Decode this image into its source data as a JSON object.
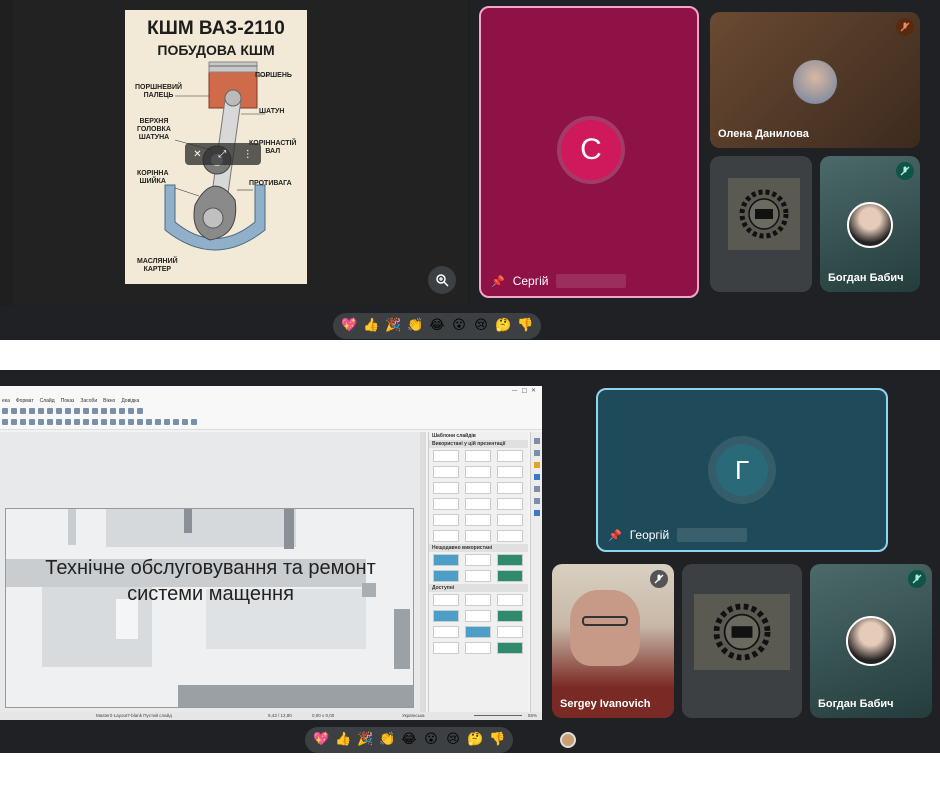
{
  "screenshot1": {
    "poster": {
      "title": "КШМ ВАЗ-2110",
      "subtitle": "ПОБУДОВА КШМ",
      "labels": {
        "piston": "ПОРШЕНЬ",
        "pin": "ПОРШНЕВИЙ\nПАЛЕЦЬ",
        "rod": "ШАТУН",
        "upper_head": "ВЕРХНЯ\nГОЛОВКА\nШАТУНА",
        "crankshaft": "КОРІННАСТІЙ\nВАЛ",
        "journal": "КОРІННА\nШИЙКА",
        "counterweight": "ПРОТИВАГА",
        "oil_pan": "МАСЛЯНИЙ\nКАРТЕР"
      }
    },
    "pinned_participant": {
      "initial": "С",
      "name": "Сергій"
    },
    "participants": [
      {
        "name": "Олена Данилова"
      },
      {
        "name": ""
      },
      {
        "name": "Богдан Бабич"
      }
    ],
    "colors": {
      "pinned_bg": "#8e1246",
      "avatar_bg": "#d0185c",
      "highlight_border": "#f3a6c8"
    }
  },
  "screenshot2": {
    "app_menu": [
      "ека",
      "Формат",
      "Слайд",
      "Показ",
      "Засоби",
      "Вікно",
      "Довідка"
    ],
    "slide_title": "Технічне обслуговування та ремонт системи мащення",
    "sidebar": {
      "title": "Шаблони слайдів",
      "sec_used": "Використані у цій презентації",
      "sec_recent": "Нещодавно використані",
      "sec_available": "Доступні"
    },
    "status": {
      "master": "Master2-Layout7-blank Пустий слайд",
      "pos": "9,43 / 12,80",
      "size": "0,00 x 0,00",
      "lang": "Українська",
      "zoom": "55%"
    },
    "pinned_participant": {
      "initial": "Г",
      "name": "Георгій"
    },
    "participants": [
      {
        "name": "Sergey Ivanovich"
      },
      {
        "name": ""
      },
      {
        "name": "Богдан Бабич"
      }
    ],
    "colors": {
      "pinned_bg": "#1f4a59",
      "avatar_bg": "#2a6a78",
      "highlight_border": "#8fd5ef"
    }
  },
  "reactions": [
    "sparkling-heart",
    "thumbs-up",
    "party-popper",
    "clapping-hands",
    "tears-of-joy",
    "surprised",
    "crying",
    "thinking",
    "thumbs-down"
  ],
  "reaction_glyphs": [
    "💖",
    "👍",
    "🎉",
    "👏",
    "😂",
    "😮",
    "😢",
    "🤔",
    "👎"
  ]
}
